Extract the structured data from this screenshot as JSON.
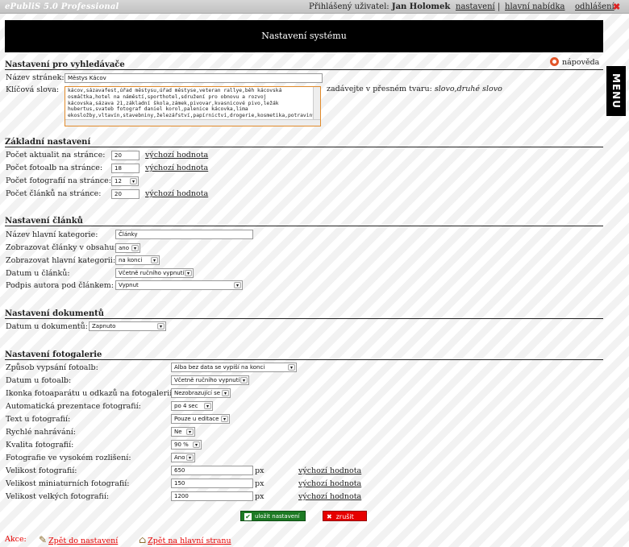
{
  "topbar": {
    "brand": "ePubliS 5.0 Professional",
    "user_prefix": "Přihlášený uživatel:",
    "user_name": "Jan Holomek",
    "link_settings": "nastavení",
    "separator": "|",
    "link_main_menu": "hlavní nabídka",
    "link_logout": "odhlášení"
  },
  "banner": {
    "title": "Nastavení systému"
  },
  "menu_tab": {
    "label": "MENU"
  },
  "help": {
    "label": "nápověda"
  },
  "search": {
    "title": "Nastavení pro vyhledávače",
    "page_name_label": "Název stránek:",
    "page_name_value": "Městys Kácov",
    "keywords_label": "Klíčová slova:",
    "keywords_value": "kácov,sázavafest,úřad městysu,úřad městyse,veteran rallye,běh kácovská osmáčtka,hotel na náměstí,sporthotel,sdružení pro obnovu a rozvoj kácovska,sázava 21,základní škola,zámek,pivovar,kvasnicové pivo,ležák hubertus,svateb fotograf daniel korol,palenice kácovka,lima ekosložby,vltavín,stavebniny,železářství,papírnictví,drogerie,kosmetika,potraviny",
    "hint_prefix": "zadávejte v přesném tvaru:",
    "hint_format": "slovo,druhé slovo"
  },
  "basic": {
    "title": "Základní nastavení",
    "rows": [
      {
        "label": "Počet aktualit na stránce:",
        "value": "20",
        "default": "výchozí hodnota"
      },
      {
        "label": "Počet fotoalb na stránce:",
        "value": "18",
        "default": "výchozí hodnota"
      },
      {
        "label": "Počet fotografií na stránce:",
        "value": "12"
      },
      {
        "label": "Počet článků na stránce:",
        "value": "20",
        "default": "výchozí hodnota"
      }
    ]
  },
  "articles": {
    "title": "Nastavení článků",
    "rows": [
      {
        "label": "Název hlavní kategorie:",
        "value": "Články"
      },
      {
        "label": "Zobrazovat články v obsahu:",
        "value": "ano"
      },
      {
        "label": "Zobrazovat hlavní kategorii:",
        "value": "na konci"
      },
      {
        "label": "Datum u článků:",
        "value": "Včetně ručního vypnutí"
      },
      {
        "label": "Podpis autora pod článkem:",
        "value": "Vypnut"
      }
    ]
  },
  "documents": {
    "title": "Nastavení dokumentů",
    "date_label": "Datum u dokumentů:",
    "date_value": "Zapnuto"
  },
  "gallery": {
    "title": "Nastavení fotogalerie",
    "rows": [
      {
        "label": "Způsob vypsání fotoalb:",
        "value": "Alba bez data se vypíší na konci"
      },
      {
        "label": "Datum u fotoalb:",
        "value": "Včetně ručního vypnutí"
      },
      {
        "label": "Ikonka fotoaparátu u odkazů na fotogalerii:",
        "value": "Nezobrazující se"
      },
      {
        "label": "Automatická prezentace fotografií:",
        "value": "po 4 sec"
      },
      {
        "label": "Text u fotografií:",
        "value": "Pouze u editace"
      },
      {
        "label": "Rychlé nahrávání:",
        "value": "Ne"
      },
      {
        "label": "Kvalita fotografií:",
        "value": "90 %"
      },
      {
        "label": "Fotografie ve vysokém rozlišení:",
        "value": "Ano"
      },
      {
        "label": "Velikost fotografií:",
        "value": "650",
        "unit": "px",
        "default": "výchozí hodnota"
      },
      {
        "label": "Velikost miniaturních fotografií:",
        "value": "150",
        "unit": "px",
        "default": "výchozí hodnota"
      },
      {
        "label": "Velikost velkých fotografií:",
        "value": "1200",
        "unit": "px",
        "default": "výchozí hodnota"
      }
    ]
  },
  "buttons": {
    "save": "uložit nastavení",
    "cancel": "zrušit"
  },
  "actions": {
    "label": "Akce:",
    "back_settings": "Zpět do nastavení",
    "back_home": "Zpět na hlavní stranu"
  },
  "colors": {
    "banner_bg": "#000000",
    "save_bg": "#1d7a24",
    "cancel_bg": "#e60000",
    "action_red": "#e60000",
    "textarea_border": "#e08a2a"
  }
}
